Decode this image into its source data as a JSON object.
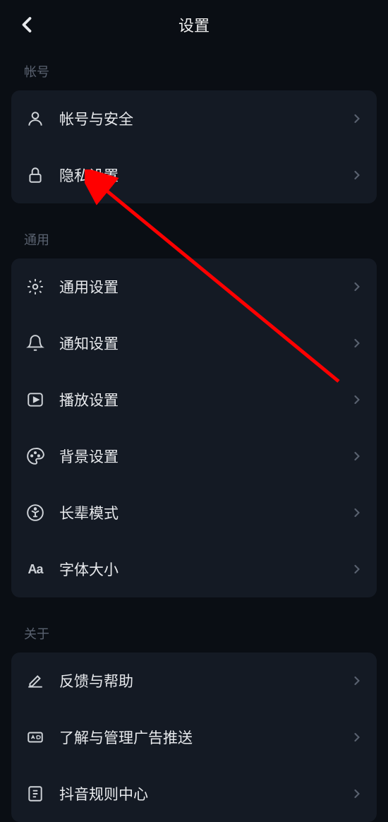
{
  "header": {
    "title": "设置"
  },
  "sections": {
    "account": {
      "title": "帐号",
      "items": [
        {
          "label": "帐号与安全"
        },
        {
          "label": "隐私设置"
        }
      ]
    },
    "general": {
      "title": "通用",
      "items": [
        {
          "label": "通用设置"
        },
        {
          "label": "通知设置"
        },
        {
          "label": "播放设置"
        },
        {
          "label": "背景设置"
        },
        {
          "label": "长辈模式"
        },
        {
          "label": "字体大小"
        }
      ]
    },
    "about": {
      "title": "关于",
      "items": [
        {
          "label": "反馈与帮助"
        },
        {
          "label": "了解与管理广告推送"
        },
        {
          "label": "抖音规则中心"
        }
      ]
    }
  }
}
